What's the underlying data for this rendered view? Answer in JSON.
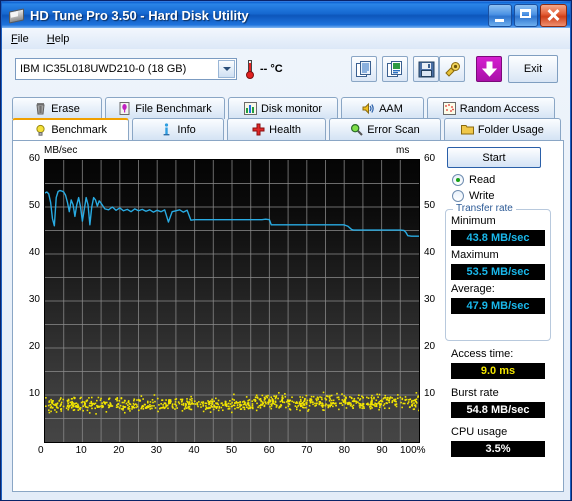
{
  "window": {
    "title": "HD Tune Pro 3.50 - Hard Disk Utility",
    "icon": "disk-icon",
    "minimize": "minimize-icon",
    "maximize": "maximize-icon",
    "close": "close-icon"
  },
  "menu": {
    "items": [
      "File",
      "Help"
    ]
  },
  "toolbar": {
    "drive": "IBM    IC35L018UWD210-0 (18 GB)",
    "temperature": "-- °C",
    "buttons": [
      {
        "name": "copy-text-icon",
        "title": "Copy text"
      },
      {
        "name": "copy-image-icon",
        "title": "Copy image"
      },
      {
        "name": "save-icon",
        "title": "Save"
      },
      {
        "name": "settings-icon",
        "title": "Options"
      },
      {
        "name": "download-icon",
        "title": "Download"
      }
    ],
    "exit_label": "Exit"
  },
  "tabs": {
    "row1": [
      {
        "label": "Erase",
        "icon": "trash-icon",
        "active": false
      },
      {
        "label": "File Benchmark",
        "icon": "file-benchmark-icon",
        "active": false
      },
      {
        "label": "Disk monitor",
        "icon": "bar-chart-icon",
        "active": false
      },
      {
        "label": "AAM",
        "icon": "speaker-icon",
        "active": false
      },
      {
        "label": "Random Access",
        "icon": "random-access-icon",
        "active": false
      }
    ],
    "row2": [
      {
        "label": "Benchmark",
        "icon": "bulb-icon",
        "active": true
      },
      {
        "label": "Info",
        "icon": "info-icon",
        "active": false
      },
      {
        "label": "Health",
        "icon": "health-cross-icon",
        "active": false
      },
      {
        "label": "Error Scan",
        "icon": "magnifier-icon",
        "active": false
      },
      {
        "label": "Folder Usage",
        "icon": "folder-icon",
        "active": false
      }
    ]
  },
  "panel": {
    "start_label": "Start",
    "read_label": "Read",
    "write_label": "Write",
    "read_selected": true,
    "write_selected": false,
    "transfer_rate_legend": "Transfer rate",
    "minimum_label": "Minimum",
    "minimum_value": "43.8 MB/sec",
    "maximum_label": "Maximum",
    "maximum_value": "53.5 MB/sec",
    "average_label": "Average:",
    "average_value": "47.9 MB/sec",
    "access_time_label": "Access time:",
    "access_time_value": "9.0 ms",
    "burst_rate_label": "Burst rate",
    "burst_rate_value": "54.8 MB/sec",
    "cpu_usage_label": "CPU usage",
    "cpu_usage_value": "3.5%"
  },
  "colors": {
    "transfer_curve": "#29ABE2",
    "access_dots": "#F2E500",
    "grid": "#8c8c8c",
    "accent": "#f0a000"
  },
  "chart_data": {
    "type": "line",
    "title": "",
    "xlabel": "",
    "ylabel": "MB/sec",
    "y2label": "ms",
    "xlim": [
      0,
      100
    ],
    "ylim": [
      0,
      60
    ],
    "y2lim": [
      0,
      60
    ],
    "grid": true,
    "xticks": [
      "0",
      "10",
      "20",
      "30",
      "40",
      "50",
      "60",
      "70",
      "80",
      "90",
      "100%"
    ],
    "yticks": [
      60,
      50,
      40,
      30,
      20,
      10
    ],
    "y2ticks": [
      60,
      50,
      40,
      30,
      20,
      10
    ],
    "legend": "none",
    "series": [
      {
        "name": "Transfer rate",
        "unit": "MB/sec",
        "axis": "left",
        "color": "#29ABE2",
        "x": [
          0,
          0.5,
          1,
          1.5,
          2,
          2.5,
          3,
          3.5,
          4,
          4.5,
          5,
          5.5,
          6,
          6.5,
          7,
          7.5,
          8,
          8.5,
          9,
          9.5,
          10,
          10.5,
          11,
          11.5,
          12,
          12.5,
          13,
          13.5,
          14,
          14.5,
          15,
          16,
          17,
          18,
          19,
          20,
          21,
          22,
          23,
          24,
          25,
          26,
          27,
          28,
          29,
          30,
          31,
          32,
          33,
          34,
          35,
          36,
          37,
          38,
          39,
          40,
          45,
          50,
          55,
          58,
          59,
          60,
          60.5,
          61,
          65,
          70,
          75,
          80,
          81,
          82,
          82.5,
          85,
          90,
          95,
          96,
          96.5,
          97,
          98,
          99,
          100
        ],
        "y": [
          53.0,
          53.2,
          52.8,
          51.0,
          47.5,
          46.0,
          52.0,
          53.3,
          53.5,
          53.4,
          53.2,
          52.5,
          51.0,
          49.0,
          51.5,
          50.5,
          48.0,
          50.5,
          52.0,
          50.0,
          47.0,
          49.5,
          52.0,
          50.5,
          46.2,
          50.0,
          52.0,
          51.5,
          50.2,
          51.3,
          50.8,
          49.6,
          49.4,
          50.0,
          49.3,
          49.8,
          49.2,
          49.5,
          49.0,
          49.6,
          49.2,
          49.5,
          49.1,
          49.4,
          48.9,
          49.3,
          49.0,
          49.4,
          46.8,
          49.0,
          49.2,
          49.4,
          48.9,
          49.3,
          47.2,
          47.3,
          47.3,
          47.3,
          47.3,
          47.3,
          47.4,
          47.3,
          46.2,
          46.2,
          46.2,
          46.2,
          46.2,
          46.2,
          45.9,
          45.2,
          45.1,
          45.1,
          45.1,
          45.1,
          45.0,
          44.6,
          43.9,
          43.8,
          43.8,
          43.8
        ]
      },
      {
        "name": "Access time",
        "unit": "ms",
        "axis": "right",
        "color": "#F2E500",
        "type": "scatter",
        "description": "Dense scatter cloud of seek times spread over 0-100% of the disk, concentrated between about 5 and 12 ms with an average of 9.0 ms",
        "mean": 9.0,
        "spread_min": 3.5,
        "spread_max": 14.0,
        "point_count": 900
      }
    ]
  }
}
